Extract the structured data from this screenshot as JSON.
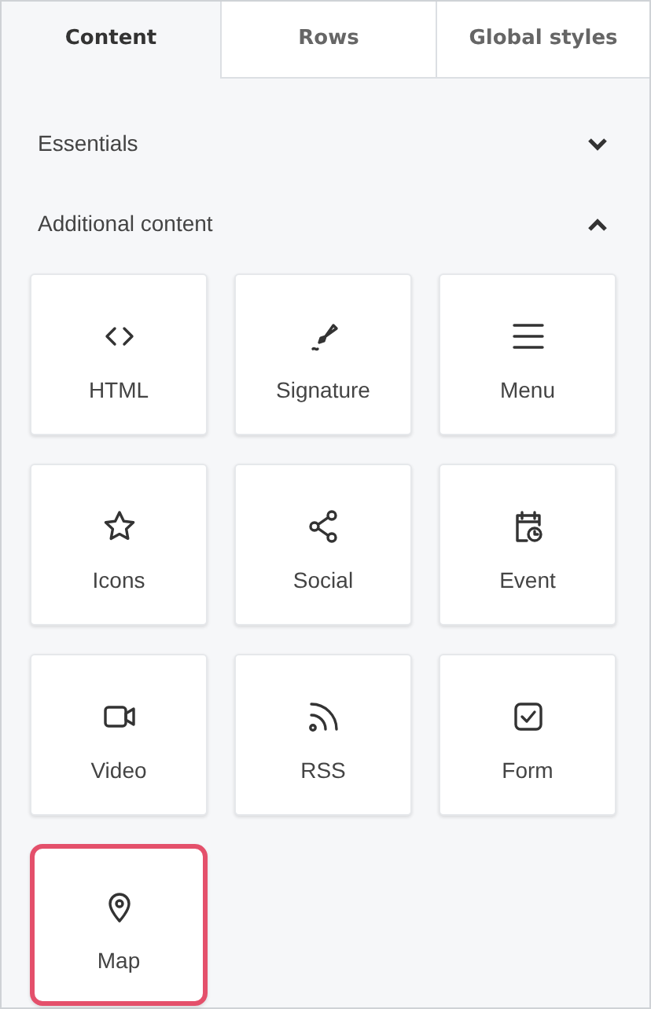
{
  "tabs": [
    {
      "label": "Content",
      "selected": true
    },
    {
      "label": "Rows",
      "selected": false
    },
    {
      "label": "Global styles",
      "selected": false
    }
  ],
  "sections": [
    {
      "title": "Essentials",
      "expanded": false
    },
    {
      "title": "Additional content",
      "expanded": true,
      "tiles": [
        {
          "label": "HTML",
          "selected": false
        },
        {
          "label": "Signature",
          "selected": false
        },
        {
          "label": "Menu",
          "selected": false
        },
        {
          "label": "Icons",
          "selected": false
        },
        {
          "label": "Social",
          "selected": false
        },
        {
          "label": "Event",
          "selected": false
        },
        {
          "label": "Video",
          "selected": false
        },
        {
          "label": "RSS",
          "selected": false
        },
        {
          "label": "Form",
          "selected": false
        },
        {
          "label": "Map",
          "selected": true
        }
      ]
    }
  ]
}
